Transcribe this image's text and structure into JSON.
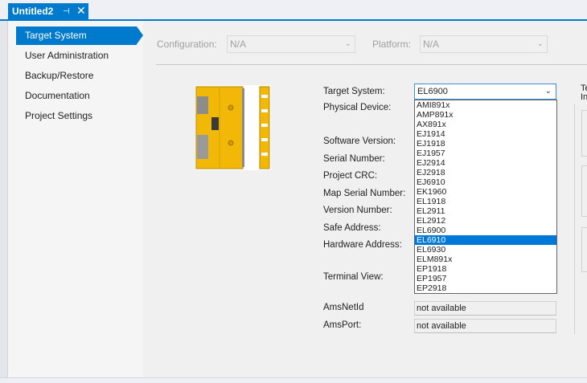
{
  "tab": {
    "title": "Untitled2",
    "pin_icon": "⊣",
    "close_icon": "✕"
  },
  "sidebar": {
    "items": [
      {
        "label": "Target System",
        "active": true
      },
      {
        "label": "User Administration"
      },
      {
        "label": "Backup/Restore"
      },
      {
        "label": "Documentation"
      },
      {
        "label": "Project Settings"
      }
    ]
  },
  "config_bar": {
    "configuration_label": "Configuration:",
    "configuration_value": "N/A",
    "platform_label": "Platform:",
    "platform_value": "N/A"
  },
  "form": {
    "target_system_label": "Target System:",
    "target_system_value": "EL6900",
    "physical_device_label": "Physical Device:",
    "software_version_label": "Software Version:",
    "serial_number_label": "Serial Number:",
    "project_crc_label": "Project CRC:",
    "map_serial_number_label": "Map Serial Number:",
    "version_number_label": "Version Number:",
    "safe_address_label": "Safe Address:",
    "hardware_address_label": "Hardware Address:",
    "terminal_view_label": "Terminal View:",
    "ams_net_id_label": "AmsNetId",
    "ams_net_id_value": "not available",
    "ams_port_label": "AmsPort:",
    "ams_port_value": "not available"
  },
  "dropdown": {
    "options": [
      "AMI891x",
      "AMP891x",
      "AX891x",
      "EJ1914",
      "EJ1918",
      "EJ1957",
      "EJ2914",
      "EJ2918",
      "EJ6910",
      "EK1960",
      "EL1918",
      "EL2911",
      "EL2912",
      "EL6900",
      "EL6910",
      "EL6930",
      "ELM891x",
      "EP1918",
      "EP1957",
      "EP2918"
    ],
    "selected": "EL6910"
  },
  "right_panel": {
    "heading_line1": "Te",
    "heading_line2": "In"
  },
  "colors": {
    "accent": "#007acc",
    "selection": "#0078d7",
    "terminal_yellow": "#f2b807"
  }
}
